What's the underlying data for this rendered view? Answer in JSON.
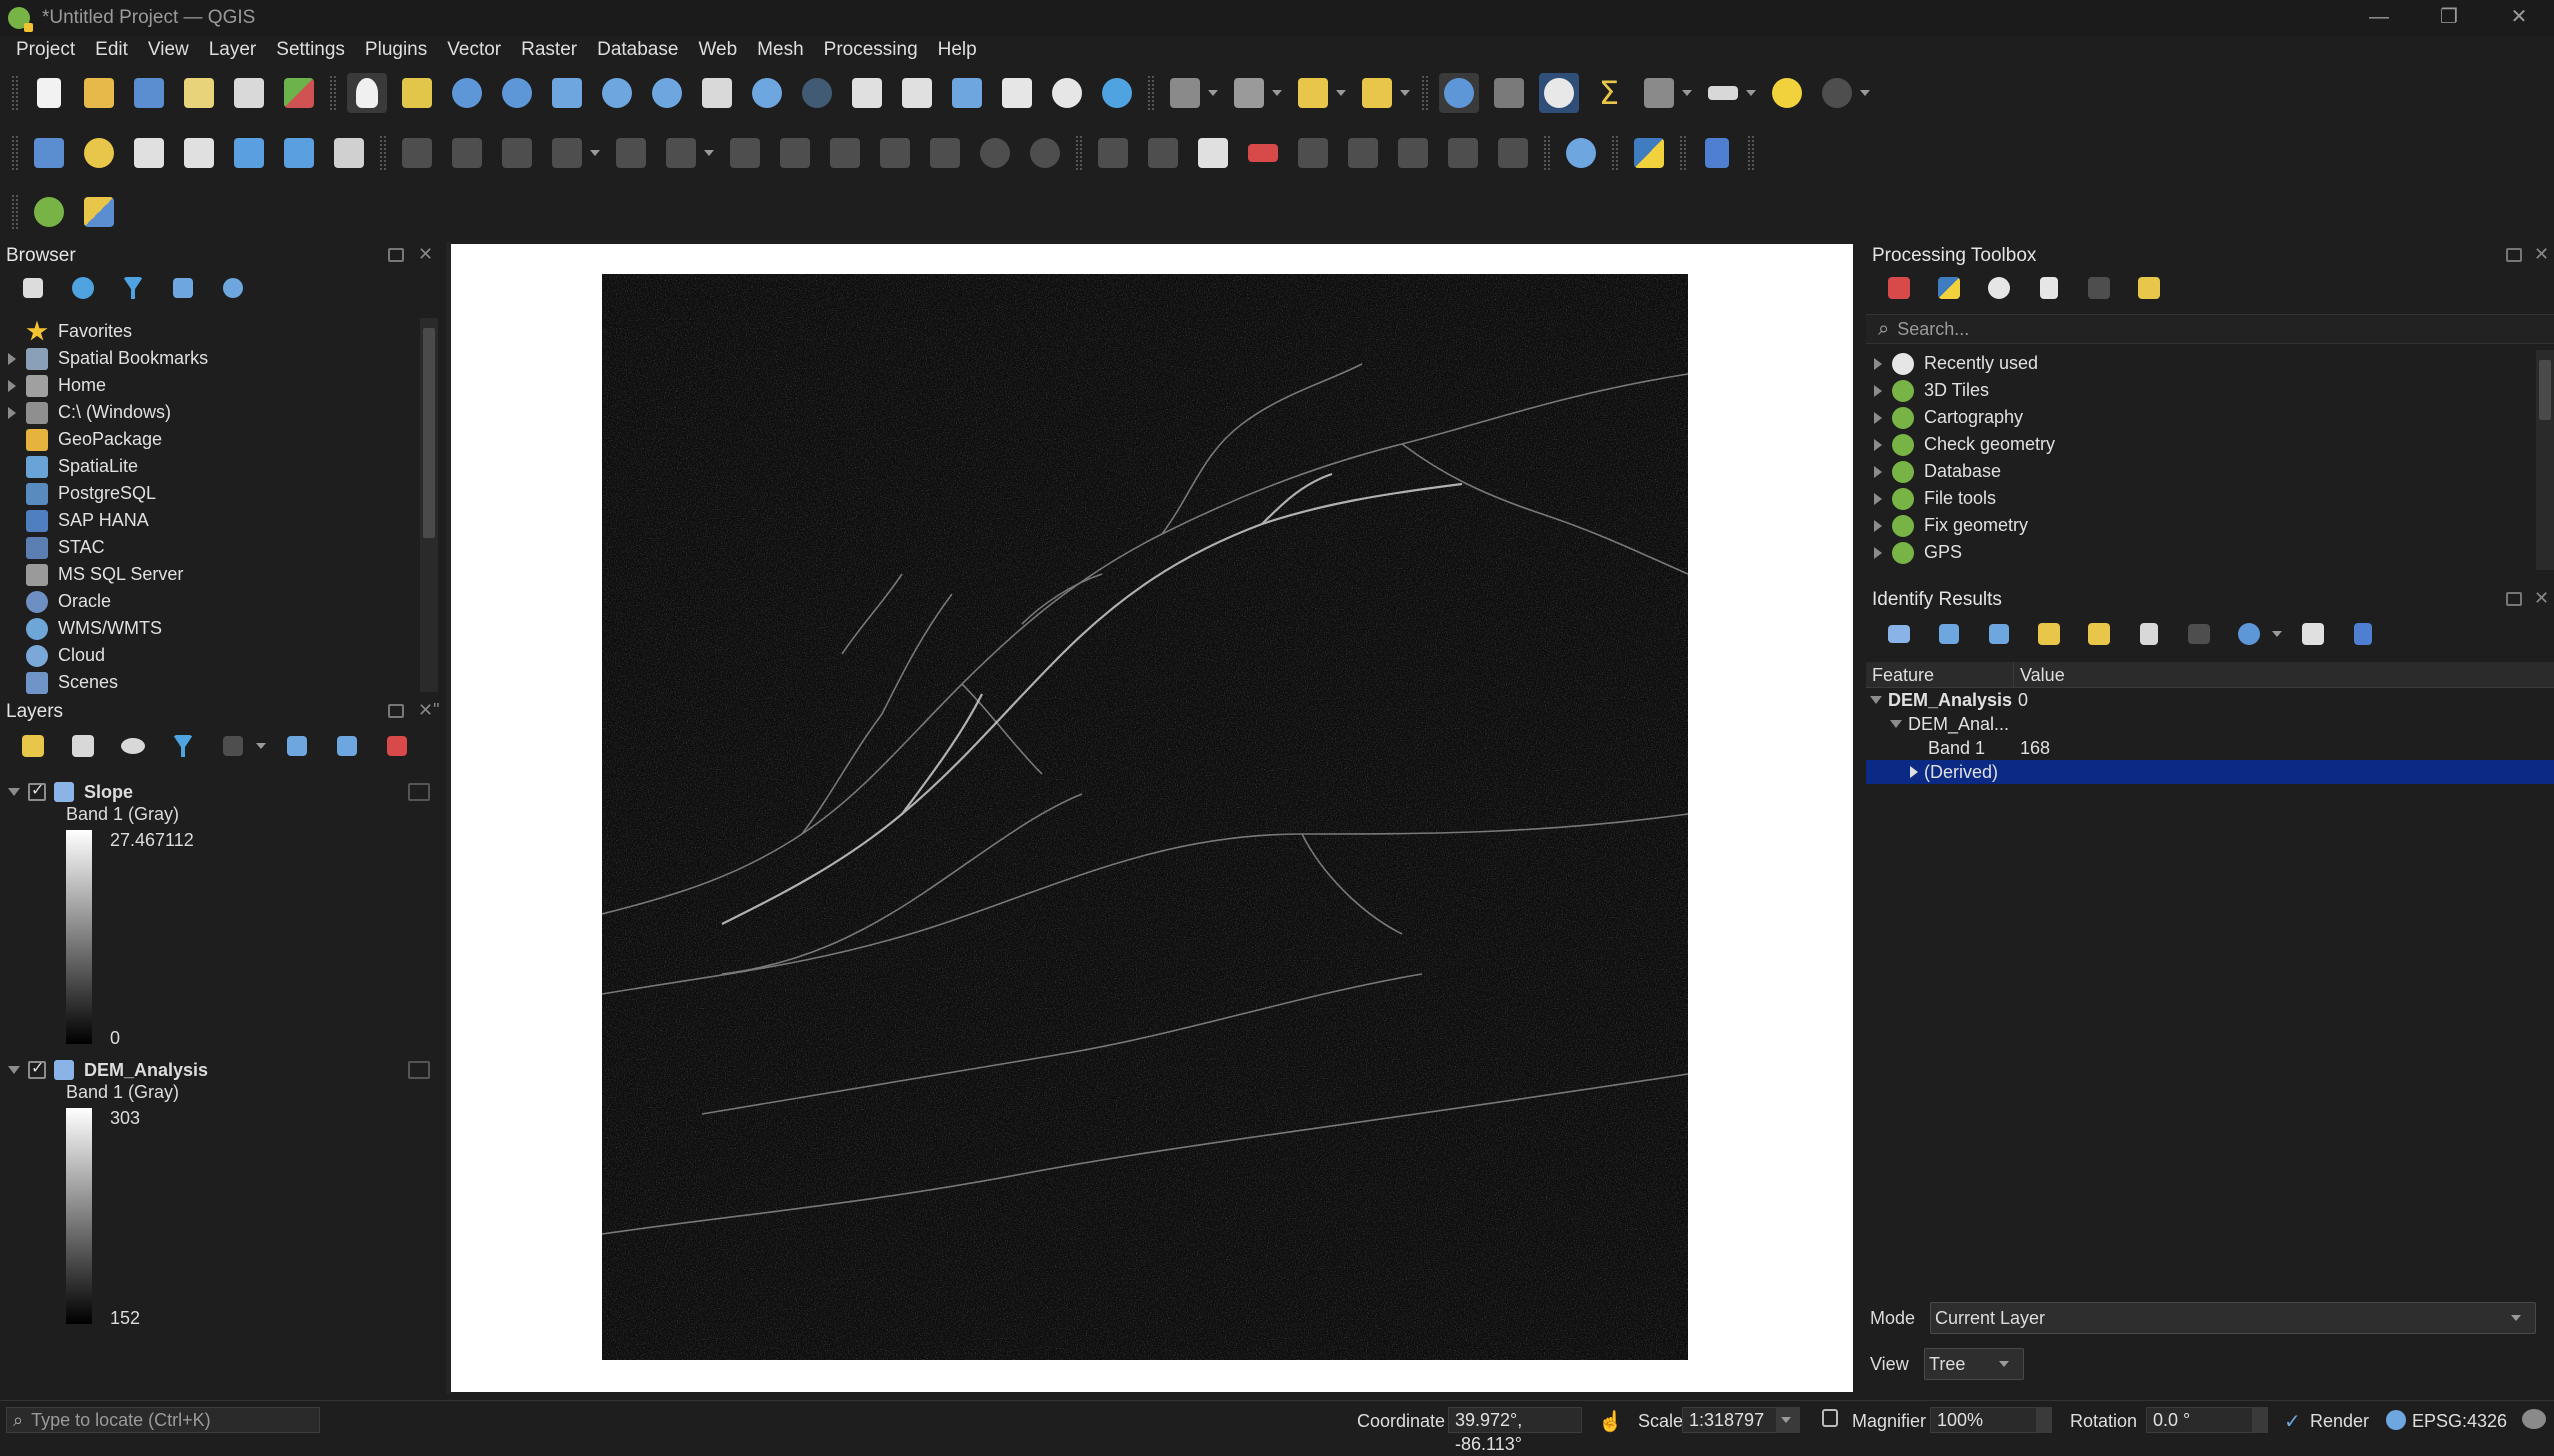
{
  "window": {
    "title": "*Untitled Project — QGIS",
    "minimize": "—",
    "maximize": "❐",
    "close": "✕"
  },
  "menu": [
    "Project",
    "Edit",
    "View",
    "Layer",
    "Settings",
    "Plugins",
    "Vector",
    "Raster",
    "Database",
    "Web",
    "Mesh",
    "Processing",
    "Help"
  ],
  "browser": {
    "title": "Browser",
    "items": [
      {
        "label": "Favorites",
        "icon": "star-icon",
        "color": "#f1c232",
        "expand": false
      },
      {
        "label": "Spatial Bookmarks",
        "icon": "bookmark-icon",
        "color": "#8aa0b8",
        "expand": true
      },
      {
        "label": "Home",
        "icon": "home-folder-icon",
        "color": "#a0a0a0",
        "expand": true
      },
      {
        "label": "C:\\ (Windows)",
        "icon": "drive-icon",
        "color": "#8f8f8f",
        "expand": true
      },
      {
        "label": "GeoPackage",
        "icon": "geopackage-icon",
        "color": "#e6b43c",
        "expand": false
      },
      {
        "label": "SpatiaLite",
        "icon": "spatialite-icon",
        "color": "#6aa3d8",
        "expand": false
      },
      {
        "label": "PostgreSQL",
        "icon": "postgresql-icon",
        "color": "#5a8bbf",
        "expand": false
      },
      {
        "label": "SAP HANA",
        "icon": "sap-hana-icon",
        "color": "#4f7fbf",
        "expand": false
      },
      {
        "label": "STAC",
        "icon": "stac-icon",
        "color": "#5b7fb0",
        "expand": false
      },
      {
        "label": "MS SQL Server",
        "icon": "mssql-icon",
        "color": "#9a9a9a",
        "expand": false
      },
      {
        "label": "Oracle",
        "icon": "oracle-icon",
        "color": "#6e8fc2",
        "expand": false
      },
      {
        "label": "WMS/WMTS",
        "icon": "globe-icon",
        "color": "#6ea6d8",
        "expand": false
      },
      {
        "label": "Cloud",
        "icon": "cloud-icon",
        "color": "#7aa8d8",
        "expand": false
      },
      {
        "label": "Scenes",
        "icon": "scenes-icon",
        "color": "#6f95c8",
        "expand": false
      }
    ]
  },
  "layers": {
    "title": "Layers",
    "items": [
      {
        "name": "Slope",
        "band": "Band 1 (Gray)",
        "max": "27.467112",
        "min": "0"
      },
      {
        "name": "DEM_Analysis",
        "band": "Band 1 (Gray)",
        "max": "303",
        "min": "152"
      }
    ]
  },
  "processing": {
    "title": "Processing Toolbox",
    "search_placeholder": "Search...",
    "items": [
      "Recently used",
      "3D Tiles",
      "Cartography",
      "Check geometry",
      "Database",
      "File tools",
      "Fix geometry",
      "GPS"
    ]
  },
  "identify": {
    "title": "Identify Results",
    "col_feature": "Feature",
    "col_value": "Value",
    "layer": "DEM_Analysis",
    "layer_value": "0",
    "sublayer": "DEM_Anal...",
    "band_label": "Band 1",
    "band_value": "168",
    "derived": "(Derived)",
    "mode_label": "Mode",
    "mode_value": "Current Layer",
    "view_label": "View",
    "view_value": "Tree"
  },
  "status": {
    "locate_placeholder": "Type to locate (Ctrl+K)",
    "coord_label": "Coordinate",
    "coord_value": "39.972°, -86.113°",
    "scale_label": "Scale",
    "scale_value": "1:318797",
    "magnifier_label": "Magnifier",
    "magnifier_value": "100%",
    "rotation_label": "Rotation",
    "rotation_value": "0.0 °",
    "render_label": "Render",
    "crs": "EPSG:4326"
  },
  "colors": {
    "selection": "#0a2a85",
    "qgis_green": "#78b445"
  }
}
